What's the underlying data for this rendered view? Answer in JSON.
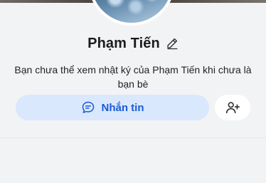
{
  "profile": {
    "name": "Phạm Tiến",
    "privacy_notice": "Bạn chưa thể xem nhật ký của Phạm Tiến khi chưa là bạn bè"
  },
  "actions": {
    "message_label": "Nhắn tin",
    "message_icon": "chat-bubble-icon",
    "add_friend_icon": "add-friend-icon",
    "edit_icon": "pencil-icon"
  },
  "colors": {
    "accent": "#1a5ad7",
    "message_button_bg": "#d9e8fc",
    "background": "#f2f3f5"
  }
}
